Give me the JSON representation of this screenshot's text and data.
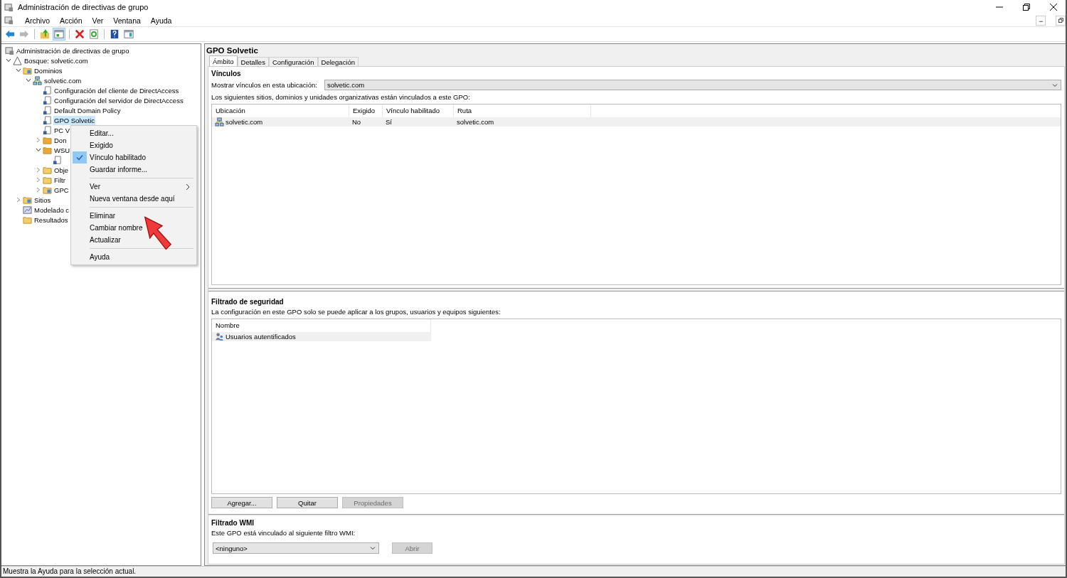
{
  "window": {
    "title": "Administración de directivas de grupo"
  },
  "menu_bar": [
    "Archivo",
    "Acción",
    "Ver",
    "Ventana",
    "Ayuda"
  ],
  "toolbar": [
    {
      "kind": "back",
      "disabled": false,
      "pressed": false
    },
    {
      "kind": "forward",
      "disabled": true,
      "pressed": false
    },
    {
      "kind": "separator"
    },
    {
      "kind": "up",
      "disabled": false,
      "pressed": false
    },
    {
      "kind": "tree",
      "disabled": false,
      "pressed": true
    },
    {
      "kind": "separator"
    },
    {
      "kind": "delete",
      "disabled": false,
      "pressed": false
    },
    {
      "kind": "refresh",
      "disabled": false,
      "pressed": false
    },
    {
      "kind": "separator"
    },
    {
      "kind": "help",
      "disabled": false,
      "pressed": false
    },
    {
      "kind": "pane",
      "disabled": false,
      "pressed": false
    }
  ],
  "tree": [
    {
      "label": "Administración de directivas de grupo",
      "kind": "console",
      "selected": false,
      "children": [
        {
          "label": "Bosque: solvetic.com",
          "kind": "forest",
          "expanded": true,
          "selected": false,
          "children": [
            {
              "label": "Dominios",
              "kind": "domains",
              "expanded": true,
              "selected": false,
              "children": [
                {
                  "label": "solvetic.com",
                  "kind": "domain",
                  "expanded": true,
                  "selected": false,
                  "children": [
                    {
                      "label": "Configuración del cliente de DirectAccess",
                      "kind": "gpo",
                      "selected": false
                    },
                    {
                      "label": "Configuración del servidor de DirectAccess",
                      "kind": "gpo",
                      "selected": false
                    },
                    {
                      "label": "Default Domain Policy",
                      "kind": "gpo",
                      "selected": false
                    },
                    {
                      "label": "GPO Solvetic",
                      "kind": "gpo",
                      "selected": true
                    },
                    {
                      "label": "PC V",
                      "kind": "gpo",
                      "selected": false
                    },
                    {
                      "label": "Don",
                      "kind": "ou",
                      "expanded": false,
                      "selected": false
                    },
                    {
                      "label": "WSU",
                      "kind": "ou",
                      "expanded": true,
                      "selected": false,
                      "children": [
                        {
                          "kind": "gpo"
                        }
                      ]
                    },
                    {
                      "label": "Obje",
                      "kind": "folder",
                      "expanded": false,
                      "selected": false
                    },
                    {
                      "label": "Filtr",
                      "kind": "filter",
                      "expanded": false,
                      "selected": false
                    },
                    {
                      "label": "GPC",
                      "kind": "starter",
                      "expanded": false,
                      "selected": false
                    }
                  ]
                }
              ]
            },
            {
              "label": "Sitios",
              "kind": "sites",
              "expanded": false,
              "selected": false
            },
            {
              "label": "Modelado c",
              "kind": "modeling",
              "selected": false
            },
            {
              "label": "Resultados",
              "kind": "results",
              "selected": false
            }
          ]
        }
      ]
    }
  ],
  "context_menu": [
    {
      "kind": "item",
      "label": "Editar...",
      "checked": false,
      "submenu": false
    },
    {
      "kind": "item",
      "label": "Exigido",
      "checked": false,
      "submenu": false
    },
    {
      "kind": "item",
      "label": "Vínculo habilitado",
      "checked": true,
      "submenu": false
    },
    {
      "kind": "item",
      "label": "Guardar informe...",
      "checked": false,
      "submenu": false
    },
    {
      "kind": "separator"
    },
    {
      "kind": "item",
      "label": "Ver",
      "checked": false,
      "submenu": true
    },
    {
      "kind": "item",
      "label": "Nueva ventana desde aquí",
      "checked": false,
      "submenu": false
    },
    {
      "kind": "separator"
    },
    {
      "kind": "item",
      "label": "Eliminar",
      "checked": false,
      "submenu": false
    },
    {
      "kind": "item",
      "label": "Cambiar nombre",
      "checked": false,
      "submenu": false
    },
    {
      "kind": "item",
      "label": "Actualizar",
      "checked": false,
      "submenu": false
    },
    {
      "kind": "separator"
    },
    {
      "kind": "item",
      "label": "Ayuda",
      "checked": false,
      "submenu": false
    }
  ],
  "details": {
    "title": "GPO Solvetic",
    "tabs": [
      {
        "label": "Ámbito",
        "selected": true
      },
      {
        "label": "Detalles",
        "selected": false
      },
      {
        "label": "Configuración",
        "selected": false
      },
      {
        "label": "Delegación",
        "selected": false
      }
    ],
    "links": {
      "heading": "Vínculos",
      "location_label": "Mostrar vínculos en esta ubicación:",
      "location_value": "solvetic.com",
      "description": "Los siguientes sitios, dominios y unidades organizativas están vinculados a este GPO:",
      "columns": [
        "Ubicación",
        "Exigido",
        "Vínculo habilitado",
        "Ruta"
      ],
      "rows": [
        {
          "cells": [
            "solvetic.com",
            "No",
            "Sí",
            "solvetic.com"
          ],
          "selected": true
        }
      ]
    },
    "security": {
      "heading": "Filtrado de seguridad",
      "description": "La configuración en este GPO solo se puede aplicar a los grupos, usuarios y equipos siguientes:",
      "columns": [
        "Nombre"
      ],
      "rows": [
        {
          "name": "Usuarios autentificados",
          "selected": true
        }
      ],
      "buttons": [
        {
          "label": "Agregar...",
          "disabled": false
        },
        {
          "label": "Quitar",
          "disabled": false
        },
        {
          "label": "Propiedades",
          "disabled": true
        }
      ]
    },
    "wmi": {
      "heading": "Filtrado WMI",
      "description": "Este GPO está vinculado al siguiente filtro WMI:",
      "value": "<ninguno>",
      "button": {
        "label": "Abrir",
        "disabled": true
      }
    }
  },
  "status_bar": "Muestra la Ayuda para la selección actual."
}
